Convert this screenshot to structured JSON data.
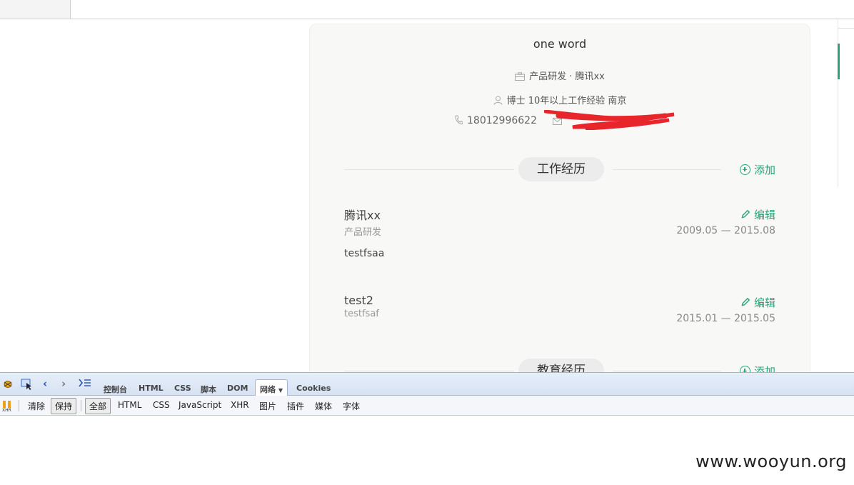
{
  "profile": {
    "name": "one word",
    "job_line": "产品研发 · 腾讯xx",
    "edu_line": "博士  10年以上工作经验  南京",
    "phone": "18012996622"
  },
  "sections": {
    "work": {
      "title": "工作经历",
      "add_label": "添加"
    },
    "education": {
      "title": "教育经历",
      "add_label": "添加"
    }
  },
  "jobs": [
    {
      "company": "腾讯xx",
      "role": "产品研发",
      "desc": "testfsaa",
      "dates": "2009.05 — 2015.08",
      "edit_label": "编辑"
    },
    {
      "company": "test2",
      "role": "testfsaf",
      "desc": "",
      "dates": "2015.01 — 2015.05",
      "edit_label": "编辑"
    }
  ],
  "devtools": {
    "tabs": [
      "控制台",
      "HTML",
      "CSS",
      "脚本",
      "DOM",
      "网络",
      "Cookies"
    ],
    "active_tab": "网络",
    "actions": {
      "clear": "清除",
      "persist": "保持"
    },
    "filters": [
      "全部",
      "HTML",
      "CSS",
      "JavaScript",
      "XHR",
      "图片",
      "插件",
      "媒体",
      "字体"
    ]
  },
  "watermark": "www.wooyun.org",
  "colors": {
    "accent": "#2aa37a",
    "redaction": "#e8252b"
  }
}
